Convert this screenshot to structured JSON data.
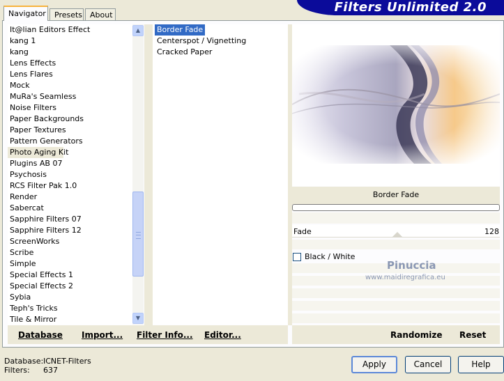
{
  "tabs": [
    "Navigator",
    "Presets",
    "About"
  ],
  "brand": "Filters Unlimited 2.0",
  "categories": [
    "It@lian Editors Effect",
    "kang 1",
    "kang",
    "Lens Effects",
    "Lens Flares",
    "Mock",
    "MuRa's Seamless",
    "Noise Filters",
    "Paper Backgrounds",
    "Paper Textures",
    "Pattern Generators",
    "Photo Aging Kit",
    "Plugins AB 07",
    "Psychosis",
    "RCS Filter Pak 1.0",
    "Render",
    "Sabercat",
    "Sapphire Filters 07",
    "Sapphire Filters 12",
    "ScreenWorks",
    "Scribe",
    "Simple",
    "Special Effects 1",
    "Special Effects 2",
    "Sybia",
    "Teph's Tricks",
    "Tile & Mirror"
  ],
  "selected_category": "Photo Aging Kit",
  "filters": [
    "Border Fade",
    "Centerspot / Vignetting",
    "Cracked Paper"
  ],
  "selected_filter": "Border Fade",
  "left_links": [
    "Database",
    "Import...",
    "Filter Info...",
    "Editor..."
  ],
  "right_links": [
    "Randomize",
    "Reset"
  ],
  "controls": {
    "title": "Border Fade",
    "slider": {
      "label": "Fade",
      "value": "128"
    },
    "checkbox": {
      "label": "Black / White",
      "checked": false
    }
  },
  "watermark": {
    "name": "Pinuccia",
    "url": "www.maidiregrafica.eu"
  },
  "status": {
    "database_label": "Database:",
    "database_value": "ICNET-Filters",
    "filters_label": "Filters:",
    "filters_value": "637"
  },
  "buttons": [
    "Apply",
    "Cancel",
    "Help"
  ],
  "icons": {
    "scroll_up": "chevron-up-icon",
    "scroll_down": "chevron-down-icon"
  }
}
